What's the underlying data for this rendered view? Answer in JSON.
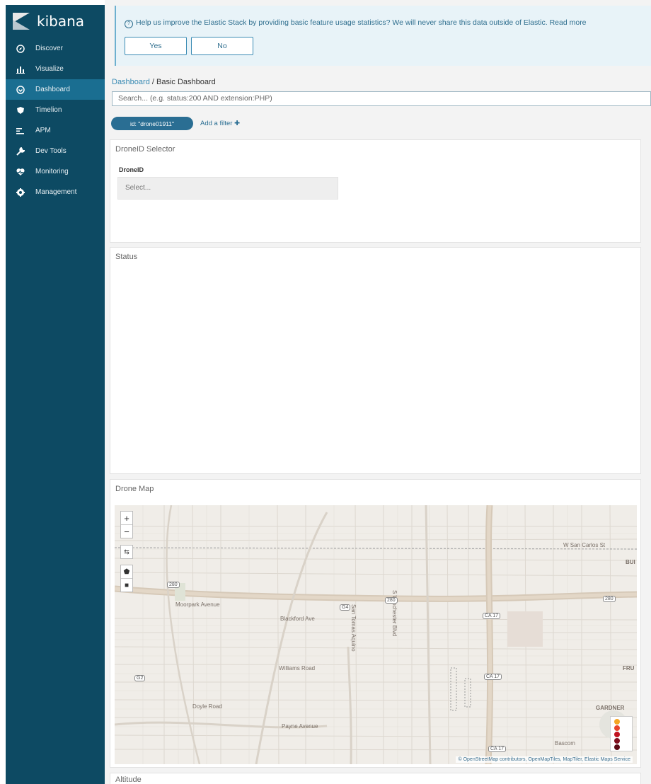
{
  "sidebar": {
    "brand": "kibana",
    "items": [
      {
        "label": "Discover",
        "icon": "compass-icon"
      },
      {
        "label": "Visualize",
        "icon": "bar-chart-icon"
      },
      {
        "label": "Dashboard",
        "icon": "dashboard-icon",
        "active": true
      },
      {
        "label": "Timelion",
        "icon": "shield-icon"
      },
      {
        "label": "APM",
        "icon": "apm-icon"
      },
      {
        "label": "Dev Tools",
        "icon": "wrench-icon"
      },
      {
        "label": "Monitoring",
        "icon": "heartbeat-icon"
      },
      {
        "label": "Management",
        "icon": "gear-icon"
      }
    ]
  },
  "banner": {
    "text": "Help us improve the Elastic Stack by providing basic feature usage statistics? We will never share this data outside of Elastic. Read more",
    "yes_label": "Yes",
    "no_label": "No"
  },
  "breadcrumb": {
    "root": "Dashboard",
    "separator": "/",
    "current": "Basic Dashboard"
  },
  "search": {
    "placeholder": "Search... (e.g. status:200 AND extension:PHP)"
  },
  "filter": {
    "pill": "id: \"drone01911\"",
    "add_label": "Add a filter"
  },
  "panels": {
    "selector": {
      "title": "DroneID Selector",
      "field_label": "DroneID",
      "select_placeholder": "Select..."
    },
    "status": {
      "title": "Status"
    },
    "map": {
      "title": "Drone Map",
      "zoom_in": "+",
      "zoom_out": "−",
      "attribution": "© OpenStreetMap contributors, OpenMapTiles, MapTiler, Elastic Maps Service",
      "labels": {
        "moorpark": "Moorpark Avenue",
        "blackford": "Blackford Ave",
        "williams": "Williams Road",
        "doyle": "Doyle Road",
        "payne": "Payne Avenue",
        "san_carlos": "W San Carlos St",
        "winchester": "S Winchester Blvd",
        "san_tomas": "San Tomas Aquino",
        "bascom": "Bascom",
        "gardner": "GARDNER",
        "bui": "BUI",
        "fru": "FRU"
      },
      "shields": {
        "g4": "G4",
        "ca17a": "CA 17",
        "ca17b": "CA 17",
        "ca17c": "CA 17",
        "g2": "G2",
        "i280a": "280",
        "i280b": "280",
        "i280c": "280"
      }
    },
    "altitude": {
      "title": "Altitude"
    }
  },
  "colors": {
    "sidebar": "#0d4a63",
    "active": "#1a6e91",
    "accent": "#2a6e93",
    "legend": [
      "#f5a623",
      "#e8452c",
      "#c1121f",
      "#800f1e",
      "#5c0a14"
    ]
  }
}
